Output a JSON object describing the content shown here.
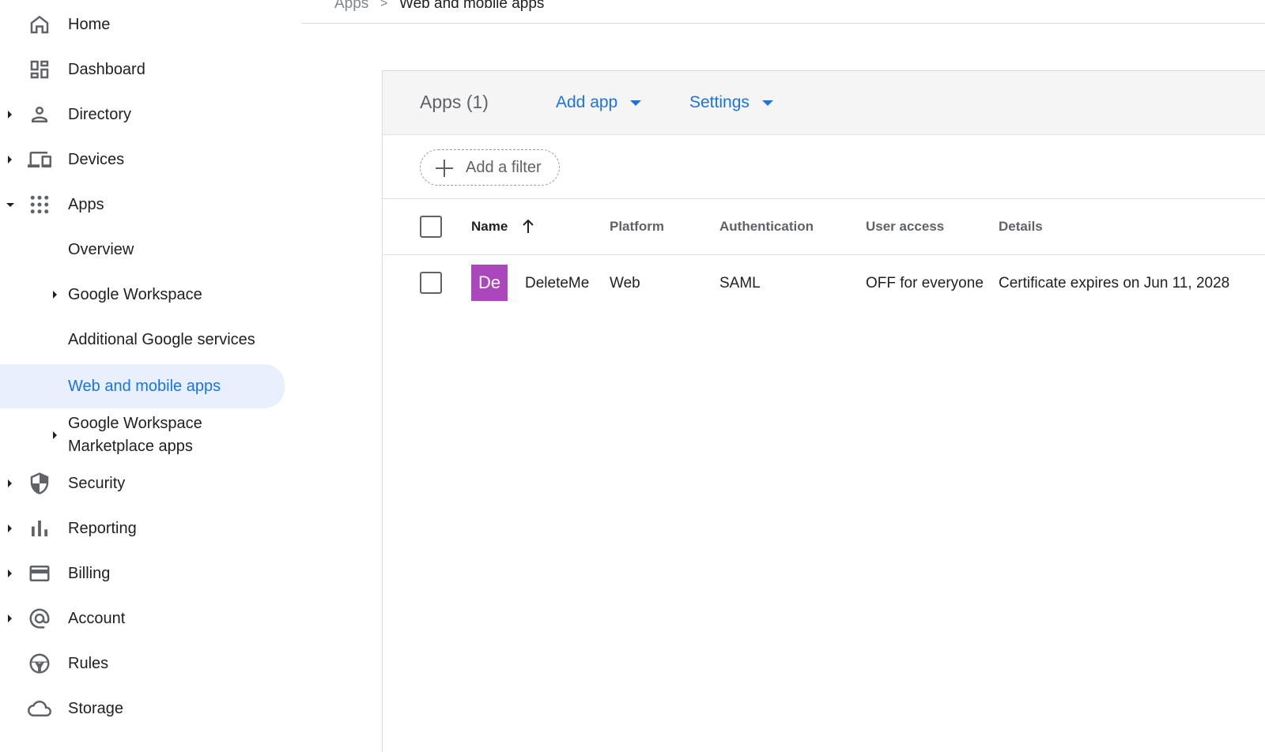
{
  "breadcrumb": {
    "parent": "Apps",
    "separator": ">",
    "current": "Web and mobile apps"
  },
  "sidebar": {
    "items": [
      {
        "label": "Home",
        "icon": "home-icon"
      },
      {
        "label": "Dashboard",
        "icon": "dashboard-icon"
      },
      {
        "label": "Directory",
        "icon": "person-icon"
      },
      {
        "label": "Devices",
        "icon": "devices-icon"
      },
      {
        "label": "Apps",
        "icon": "apps-grid-icon"
      },
      {
        "label": "Overview"
      },
      {
        "label": "Google Workspace"
      },
      {
        "label": "Additional Google services"
      },
      {
        "label": "Web and mobile apps",
        "active": true
      },
      {
        "label": "Google Workspace Marketplace apps"
      },
      {
        "label": "Security",
        "icon": "shield-icon"
      },
      {
        "label": "Reporting",
        "icon": "bar-chart-icon"
      },
      {
        "label": "Billing",
        "icon": "credit-card-icon"
      },
      {
        "label": "Account",
        "icon": "at-sign-icon"
      },
      {
        "label": "Rules",
        "icon": "rules-icon"
      },
      {
        "label": "Storage",
        "icon": "cloud-icon"
      }
    ]
  },
  "card": {
    "title": "Apps (1)",
    "add_app_label": "Add app",
    "settings_label": "Settings",
    "filter_label": "Add a filter"
  },
  "table": {
    "columns": [
      "Name",
      "Platform",
      "Authentication",
      "User access",
      "Details"
    ],
    "rows": [
      {
        "avatar": "De",
        "name": "DeleteMe",
        "platform": "Web",
        "authentication": "SAML",
        "user_access": "OFF for everyone",
        "details": "Certificate expires on Jun 11, 2028"
      }
    ]
  },
  "colors": {
    "accent": "#1a73e8",
    "active_bg": "#e8f0fe",
    "avatar_bg": "#ab47bc"
  }
}
